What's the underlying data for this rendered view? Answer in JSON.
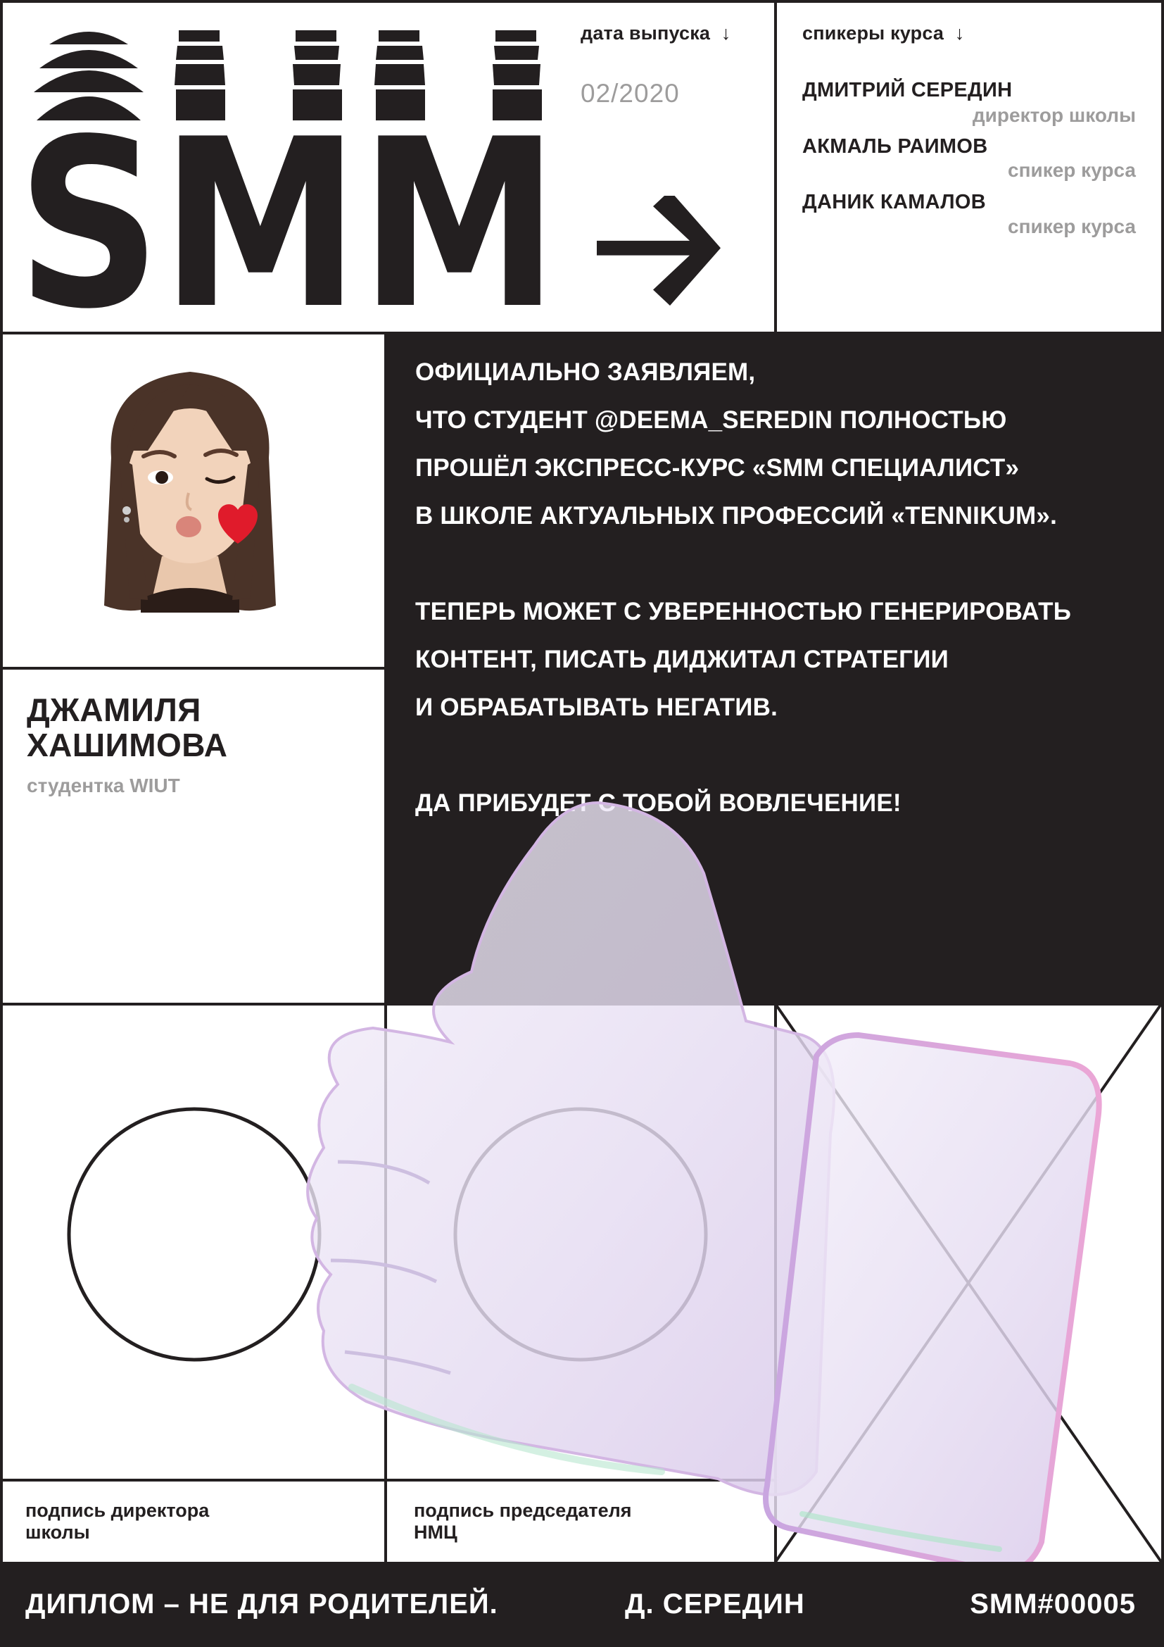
{
  "header": {
    "logo_text": "SMM",
    "release_label": "дата выпуска",
    "release_arrow": "↓",
    "release_date": "02/2020",
    "speakers_label": "спикеры курса",
    "speakers_arrow": "↓",
    "speakers": [
      {
        "name": "ДМИТРИЙ СЕРЕДИН",
        "role": "директор школы"
      },
      {
        "name": "АКМАЛЬ РАИМОВ",
        "role": "спикер курса"
      },
      {
        "name": "ДАНИК КАМАЛОВ",
        "role": "спикер курса"
      }
    ]
  },
  "student": {
    "name_line1": "ДЖАМИЛЯ",
    "name_line2": "ХАШИМОВА",
    "subtitle": "студентка WIUT"
  },
  "statement": {
    "lines": [
      "ОФИЦИАЛЬНО ЗАЯВЛЯЕМ,",
      "ЧТО СТУДЕНТ @DEEMA_SEREDIN ПОЛНОСТЬЮ",
      "ПРОШЁЛ ЭКСПРЕСС-КУРС «SMM СПЕЦИАЛИСТ»",
      "В ШКОЛЕ АКТУАЛЬНЫХ ПРОФЕССИЙ «TENNIKUM».",
      "ТЕПЕРЬ МОЖЕТ С УВЕРЕННОСТЬЮ ГЕНЕРИРОВАТЬ",
      "КОНТЕНТ, ПИСАТЬ ДИДЖИТАЛ СТРАТЕГИИ",
      "И ОБРАБАТЫВАТЬ НЕГАТИВ.",
      "ДА ПРИБУДЕТ С ТОБОЙ ВОВЛЕЧЕНИЕ!"
    ]
  },
  "signatures": {
    "director_line1": "подпись директора",
    "director_line2": "школы",
    "chairman_line1": "подпись председателя",
    "chairman_line2": "НМЦ"
  },
  "footer": {
    "slogan": "ДИПЛОМ – НЕ ДЛЯ РОДИТЕЛЕЙ.",
    "signature_name": "Д. СЕРЕДИН",
    "number": "SMM#00005"
  },
  "colors": {
    "dark": "#231f20",
    "gray_text": "#9d9c9c",
    "white": "#ffffff",
    "thumb_tint": "#e9e2f3"
  },
  "icons": [
    "arrow-right-icon",
    "avatar-memoji",
    "heart-icon",
    "thumbs-up-illustration"
  ]
}
